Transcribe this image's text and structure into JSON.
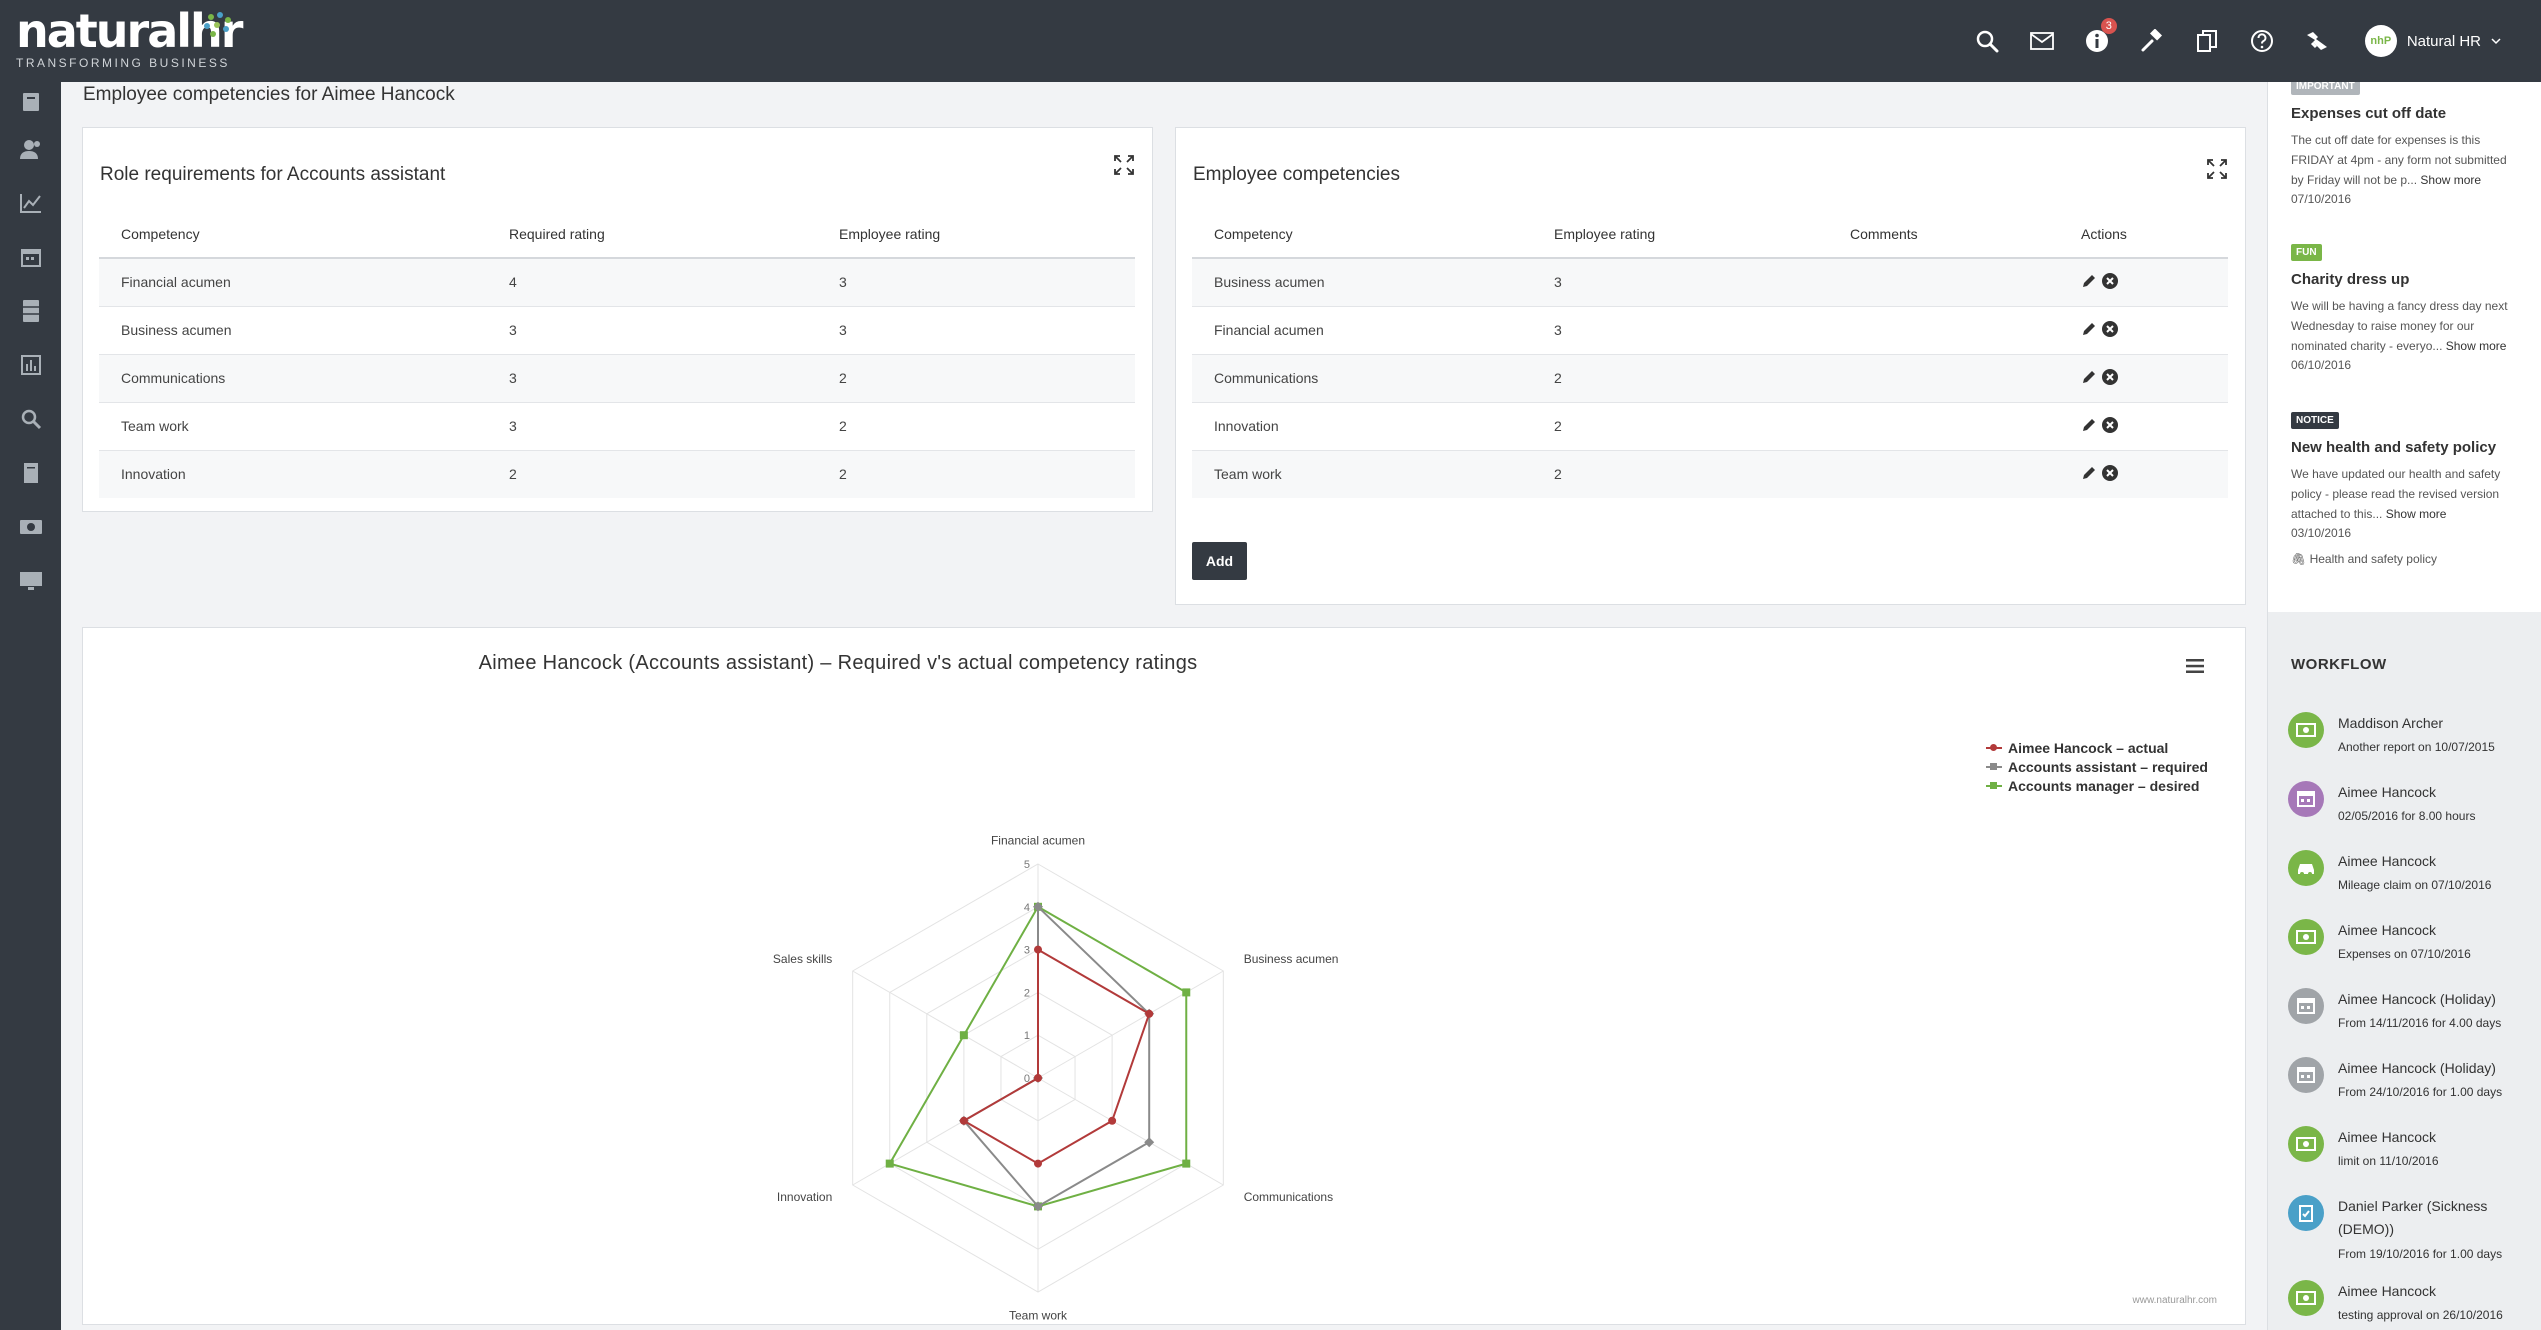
{
  "brand": {
    "name": "natural",
    "name_suffix": "hr",
    "tagline": "TRANSFORMING BUSINESS",
    "accent": "#7ab648",
    "dark": "#343a42"
  },
  "topbar": {
    "notification_count": "3",
    "user_initials": "nhP",
    "user_name": "Natural HR"
  },
  "page": {
    "title": "Employee competencies for Aimee Hancock"
  },
  "role_panel": {
    "title": "Role requirements for Accounts assistant",
    "columns": [
      "Competency",
      "Required rating",
      "Employee rating"
    ],
    "rows": [
      [
        "Financial acumen",
        "4",
        "3"
      ],
      [
        "Business acumen",
        "3",
        "3"
      ],
      [
        "Communications",
        "3",
        "2"
      ],
      [
        "Team work",
        "3",
        "2"
      ],
      [
        "Innovation",
        "2",
        "2"
      ]
    ]
  },
  "emp_panel": {
    "title": "Employee competencies",
    "columns": [
      "Competency",
      "Employee rating",
      "Comments",
      "Actions"
    ],
    "rows": [
      [
        "Business acumen",
        "3",
        ""
      ],
      [
        "Financial acumen",
        "3",
        ""
      ],
      [
        "Communications",
        "2",
        ""
      ],
      [
        "Innovation",
        "2",
        ""
      ],
      [
        "Team work",
        "2",
        ""
      ]
    ],
    "add_label": "Add"
  },
  "chart_panel": {
    "credit": "www.naturalhr.com"
  },
  "chart_data": {
    "type": "radar",
    "title": "Aimee Hancock (Accounts assistant) – Required v's actual competency ratings",
    "categories": [
      "Financial acumen",
      "Business acumen",
      "Communications",
      "Team work",
      "Innovation",
      "Sales skills"
    ],
    "radial_ticks": [
      "0",
      "1",
      "2",
      "3",
      "4",
      "5"
    ],
    "range": [
      0,
      5
    ],
    "grid": true,
    "legend_position": "top-right",
    "series": [
      {
        "name": "Aimee Hancock – actual",
        "color": "#b23a3a",
        "marker": "circle",
        "values": [
          3,
          3,
          2,
          2,
          2,
          0
        ]
      },
      {
        "name": "Accounts assistant – required",
        "color": "#8a8a8a",
        "marker": "diamond",
        "values": [
          4,
          3,
          3,
          3,
          2,
          0
        ]
      },
      {
        "name": "Accounts manager – desired",
        "color": "#6fb044",
        "marker": "square",
        "values": [
          4,
          4,
          4,
          3,
          4,
          2
        ]
      }
    ]
  },
  "notices": [
    {
      "tag": "IMPORTANT",
      "tag_color": "#b0b5ba",
      "title": "Expenses cut off date",
      "body": "The cut off date for expenses is this FRIDAY at 4pm - any form not submitted by Friday will not be p...",
      "more": "Show more",
      "date": "07/10/2016"
    },
    {
      "tag": "FUN",
      "tag_color": "#7ab648",
      "title": "Charity dress up",
      "body": "We will be having a fancy dress day next Wednesday to raise money for our nominated charity - everyo...",
      "more": "Show more",
      "date": "06/10/2016"
    },
    {
      "tag": "NOTICE",
      "tag_color": "#343a42",
      "title": "New health and safety policy",
      "body": "We have updated our health and safety policy - please read the revised version attached to this...",
      "more": "Show more",
      "date": "03/10/2016",
      "attachment": "Health and safety policy"
    }
  ],
  "workflow": {
    "title": "WORKFLOW",
    "items": [
      {
        "icon": "money-icon",
        "color": "#7ab648",
        "name": "Maddison Archer",
        "sub": "Another report on 10/07/2015"
      },
      {
        "icon": "calendar-icon",
        "color": "#a678b8",
        "name": "Aimee Hancock",
        "sub": "02/05/2016 for 8.00 hours"
      },
      {
        "icon": "car-icon",
        "color": "#7ab648",
        "name": "Aimee Hancock",
        "sub": "Mileage claim on 07/10/2016"
      },
      {
        "icon": "money-icon",
        "color": "#7ab648",
        "name": "Aimee Hancock",
        "sub": "Expenses on 07/10/2016"
      },
      {
        "icon": "calendar-icon",
        "color": "#a0a4a8",
        "name": "Aimee Hancock (Holiday)",
        "sub": "From 14/11/2016 for 4.00 days"
      },
      {
        "icon": "calendar-icon",
        "color": "#a0a4a8",
        "name": "Aimee Hancock (Holiday)",
        "sub": "From 24/10/2016 for 1.00 days"
      },
      {
        "icon": "money-icon",
        "color": "#7ab648",
        "name": "Aimee Hancock",
        "sub": "limit on 11/10/2016"
      },
      {
        "icon": "clipboard-icon",
        "color": "#4aa0c8",
        "name": "Daniel Parker (Sickness (DEMO))",
        "sub": "From 19/10/2016 for 1.00 days"
      },
      {
        "icon": "money-icon",
        "color": "#7ab648",
        "name": "Aimee Hancock",
        "sub": "testing approval on 26/10/2016"
      }
    ]
  }
}
